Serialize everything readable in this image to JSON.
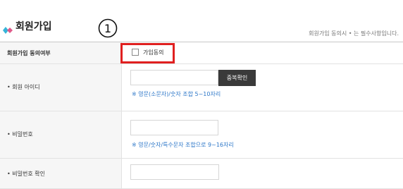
{
  "page": {
    "title": "회원가입",
    "required_note": "회원가입 동의시 • 는 필수사항입니다.",
    "step_marker": "①",
    "colors": {
      "highlight": "#e02020",
      "accent": "#36b4d8",
      "hint": "#2d77c8",
      "button": "#3a3a3a"
    }
  },
  "form": {
    "agree": {
      "label": "회원가입 동의여부",
      "checkbox_label": "가입동의",
      "checked": false
    },
    "member_id": {
      "label": "• 회원 아이디",
      "value": "",
      "button_label": "중복확인",
      "hint": "※ 영문(소문자)/숫자 조합 5~10자리"
    },
    "password": {
      "label": "• 비밀번호",
      "value": "",
      "hint": "※ 영문/숫자/특수문자 조합으로 9~16자리"
    },
    "password_confirm": {
      "label": "• 비밀번호 확인",
      "value": ""
    }
  }
}
